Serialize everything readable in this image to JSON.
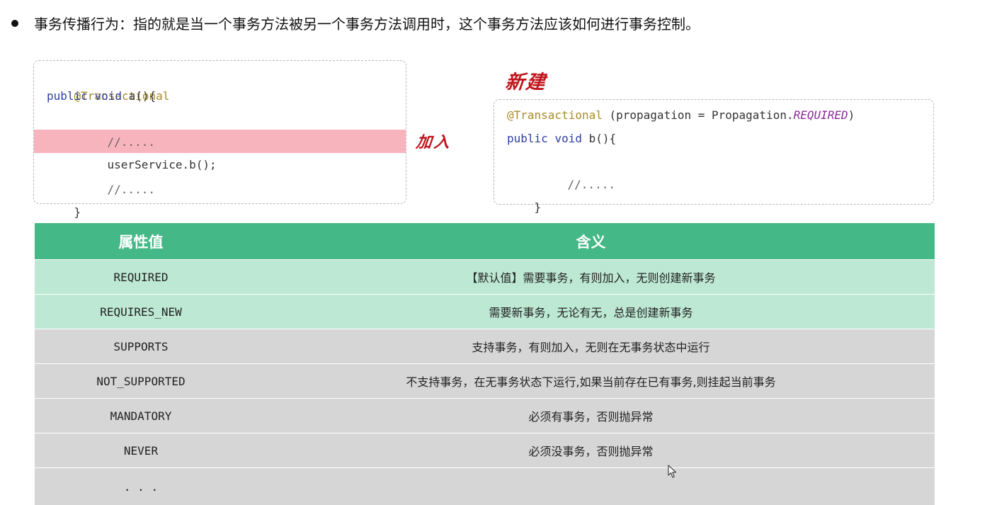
{
  "heading": "事务传播行为：指的就是当一个事务方法被另一个事务方法调用时，这个事务方法应该如何进行事务控制。",
  "code_a": {
    "annotation": "@Transactional",
    "kw_public": "public",
    "kw_void": "void",
    "method_sig": "a(){",
    "comment1": "//.....",
    "call": "userService.b();",
    "comment2": "//.....",
    "close": "}"
  },
  "code_b": {
    "annotation": "@Transactional",
    "params_start": "(propagation = Propagation.",
    "param_const": "REQUIRED",
    "params_end": ")",
    "kw_public": "public",
    "kw_void": "void",
    "method_sig": "b(){",
    "comment": "//.....",
    "close": "}"
  },
  "annotations": {
    "join": "加入",
    "new": "新建"
  },
  "table": {
    "headers": [
      "属性值",
      "含义"
    ],
    "rows": [
      {
        "value": "REQUIRED",
        "meaning": "【默认值】需要事务，有则加入，无则创建新事务"
      },
      {
        "value": "REQUIRES_NEW",
        "meaning": "需要新事务，无论有无，总是创建新事务"
      },
      {
        "value": "SUPPORTS",
        "meaning": "支持事务，有则加入，无则在无事务状态中运行"
      },
      {
        "value": "NOT_SUPPORTED",
        "meaning": "不支持事务，在无事务状态下运行,如果当前存在已有事务,则挂起当前事务"
      },
      {
        "value": "MANDATORY",
        "meaning": "必须有事务，否则抛异常"
      },
      {
        "value": "NEVER",
        "meaning": "必须没事务，否则抛异常"
      },
      {
        "value": ". . .",
        "meaning": ""
      }
    ]
  },
  "colors": {
    "header_green": "#44b886",
    "row_green": "#bde8d4",
    "row_gray": "#d6d6d6",
    "highlight_pink": "#f8b4bc",
    "hand_red": "#c0141c"
  },
  "icons": {
    "bullet": "bullet-dot",
    "cursor": "mouse-pointer-icon"
  }
}
